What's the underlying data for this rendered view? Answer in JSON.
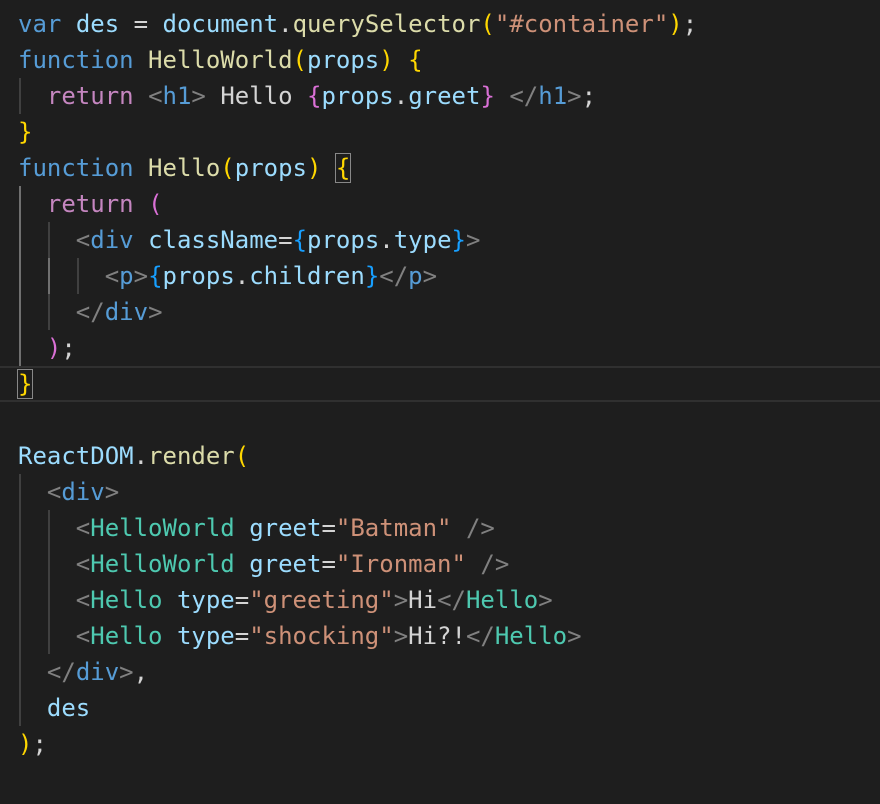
{
  "colors": {
    "background": "#1e1e1e",
    "keyword_blue": "#569cd6",
    "keyword_purple": "#c586c0",
    "variable": "#9cdcfe",
    "function_name": "#dcdcaa",
    "string": "#ce9178",
    "tag_component": "#4ec9b0",
    "tag_html": "#569cd6",
    "punctuation": "#d4d4d4",
    "tag_bracket": "#808080",
    "bracket_gold": "#ffd700",
    "bracket_purple": "#da70d6",
    "bracket_blue": "#179fff",
    "indent_guide": "#404040",
    "indent_guide_active": "#707070"
  },
  "editor": {
    "language": "javascript-jsx",
    "lines": [
      [
        [
          "var",
          "#569cd6"
        ],
        [
          " ",
          "#d4d4d4"
        ],
        [
          "des",
          "#9cdcfe"
        ],
        [
          " = ",
          "#d4d4d4"
        ],
        [
          "document",
          "#9cdcfe"
        ],
        [
          ".",
          "#d4d4d4"
        ],
        [
          "querySelector",
          "#dcdcaa"
        ],
        [
          "(",
          "#ffd700"
        ],
        [
          "\"#container\"",
          "#ce9178"
        ],
        [
          ")",
          "#ffd700"
        ],
        [
          ";",
          "#d4d4d4"
        ]
      ],
      [
        [
          "function",
          "#569cd6"
        ],
        [
          " ",
          "#d4d4d4"
        ],
        [
          "HelloWorld",
          "#dcdcaa"
        ],
        [
          "(",
          "#ffd700"
        ],
        [
          "props",
          "#9cdcfe"
        ],
        [
          ")",
          "#ffd700"
        ],
        [
          " ",
          "#d4d4d4"
        ],
        [
          "{",
          "#ffd700"
        ]
      ],
      [
        [
          "  ",
          "#d4d4d4"
        ],
        [
          "return",
          "#c586c0"
        ],
        [
          " ",
          "#d4d4d4"
        ],
        [
          "<",
          "#808080"
        ],
        [
          "h1",
          "#569cd6"
        ],
        [
          ">",
          "#808080"
        ],
        [
          " Hello ",
          "#d4d4d4"
        ],
        [
          "{",
          "#da70d6"
        ],
        [
          "props",
          "#9cdcfe"
        ],
        [
          ".",
          "#d4d4d4"
        ],
        [
          "greet",
          "#9cdcfe"
        ],
        [
          "}",
          "#da70d6"
        ],
        [
          " ",
          "#d4d4d4"
        ],
        [
          "</",
          "#808080"
        ],
        [
          "h1",
          "#569cd6"
        ],
        [
          ">",
          "#808080"
        ],
        [
          ";",
          "#d4d4d4"
        ]
      ],
      [
        [
          "}",
          "#ffd700"
        ]
      ],
      [
        [
          "function",
          "#569cd6"
        ],
        [
          " ",
          "#d4d4d4"
        ],
        [
          "Hello",
          "#dcdcaa"
        ],
        [
          "(",
          "#ffd700"
        ],
        [
          "props",
          "#9cdcfe"
        ],
        [
          ")",
          "#ffd700"
        ],
        [
          " ",
          "#d4d4d4"
        ],
        [
          "{",
          "#ffd700",
          "bm"
        ]
      ],
      [
        [
          "  ",
          "#d4d4d4"
        ],
        [
          "return",
          "#c586c0"
        ],
        [
          " ",
          "#d4d4d4"
        ],
        [
          "(",
          "#da70d6"
        ]
      ],
      [
        [
          "    ",
          "#d4d4d4"
        ],
        [
          "<",
          "#808080"
        ],
        [
          "div",
          "#569cd6"
        ],
        [
          " ",
          "#d4d4d4"
        ],
        [
          "className",
          "#9cdcfe"
        ],
        [
          "=",
          "#d4d4d4"
        ],
        [
          "{",
          "#179fff"
        ],
        [
          "props",
          "#9cdcfe"
        ],
        [
          ".",
          "#d4d4d4"
        ],
        [
          "type",
          "#9cdcfe"
        ],
        [
          "}",
          "#179fff"
        ],
        [
          ">",
          "#808080"
        ]
      ],
      [
        [
          "      ",
          "#d4d4d4"
        ],
        [
          "<",
          "#808080"
        ],
        [
          "p",
          "#569cd6"
        ],
        [
          ">",
          "#808080"
        ],
        [
          "{",
          "#179fff"
        ],
        [
          "props",
          "#9cdcfe"
        ],
        [
          ".",
          "#d4d4d4"
        ],
        [
          "children",
          "#9cdcfe"
        ],
        [
          "}",
          "#179fff"
        ],
        [
          "</",
          "#808080"
        ],
        [
          "p",
          "#569cd6"
        ],
        [
          ">",
          "#808080"
        ]
      ],
      [
        [
          "    ",
          "#d4d4d4"
        ],
        [
          "</",
          "#808080"
        ],
        [
          "div",
          "#569cd6"
        ],
        [
          ">",
          "#808080"
        ]
      ],
      [
        [
          "  ",
          "#d4d4d4"
        ],
        [
          ")",
          "#da70d6"
        ],
        [
          ";",
          "#d4d4d4"
        ]
      ],
      [
        [
          "}",
          "#ffd700",
          "bm"
        ]
      ],
      [],
      [
        [
          "ReactDOM",
          "#9cdcfe"
        ],
        [
          ".",
          "#d4d4d4"
        ],
        [
          "render",
          "#dcdcaa"
        ],
        [
          "(",
          "#ffd700"
        ]
      ],
      [
        [
          "  ",
          "#d4d4d4"
        ],
        [
          "<",
          "#808080"
        ],
        [
          "div",
          "#569cd6"
        ],
        [
          ">",
          "#808080"
        ]
      ],
      [
        [
          "    ",
          "#d4d4d4"
        ],
        [
          "<",
          "#808080"
        ],
        [
          "HelloWorld",
          "#4ec9b0"
        ],
        [
          " ",
          "#d4d4d4"
        ],
        [
          "greet",
          "#9cdcfe"
        ],
        [
          "=",
          "#d4d4d4"
        ],
        [
          "\"Batman\"",
          "#ce9178"
        ],
        [
          " ",
          "#d4d4d4"
        ],
        [
          "/>",
          "#808080"
        ]
      ],
      [
        [
          "    ",
          "#d4d4d4"
        ],
        [
          "<",
          "#808080"
        ],
        [
          "HelloWorld",
          "#4ec9b0"
        ],
        [
          " ",
          "#d4d4d4"
        ],
        [
          "greet",
          "#9cdcfe"
        ],
        [
          "=",
          "#d4d4d4"
        ],
        [
          "\"Ironman\"",
          "#ce9178"
        ],
        [
          " ",
          "#d4d4d4"
        ],
        [
          "/>",
          "#808080"
        ]
      ],
      [
        [
          "    ",
          "#d4d4d4"
        ],
        [
          "<",
          "#808080"
        ],
        [
          "Hello",
          "#4ec9b0"
        ],
        [
          " ",
          "#d4d4d4"
        ],
        [
          "type",
          "#9cdcfe"
        ],
        [
          "=",
          "#d4d4d4"
        ],
        [
          "\"greeting\"",
          "#ce9178"
        ],
        [
          ">",
          "#808080"
        ],
        [
          "Hi",
          "#d4d4d4"
        ],
        [
          "</",
          "#808080"
        ],
        [
          "Hello",
          "#4ec9b0"
        ],
        [
          ">",
          "#808080"
        ]
      ],
      [
        [
          "    ",
          "#d4d4d4"
        ],
        [
          "<",
          "#808080"
        ],
        [
          "Hello",
          "#4ec9b0"
        ],
        [
          " ",
          "#d4d4d4"
        ],
        [
          "type",
          "#9cdcfe"
        ],
        [
          "=",
          "#d4d4d4"
        ],
        [
          "\"shocking\"",
          "#ce9178"
        ],
        [
          ">",
          "#808080"
        ],
        [
          "Hi?!",
          "#d4d4d4"
        ],
        [
          "</",
          "#808080"
        ],
        [
          "Hello",
          "#4ec9b0"
        ],
        [
          ">",
          "#808080"
        ]
      ],
      [
        [
          "  ",
          "#d4d4d4"
        ],
        [
          "</",
          "#808080"
        ],
        [
          "div",
          "#569cd6"
        ],
        [
          ">",
          "#808080"
        ],
        [
          ",",
          "#d4d4d4"
        ]
      ],
      [
        [
          "  ",
          "#d4d4d4"
        ],
        [
          "des",
          "#9cdcfe"
        ]
      ],
      [
        [
          ")",
          "#ffd700"
        ],
        [
          ";",
          "#d4d4d4"
        ]
      ]
    ]
  }
}
